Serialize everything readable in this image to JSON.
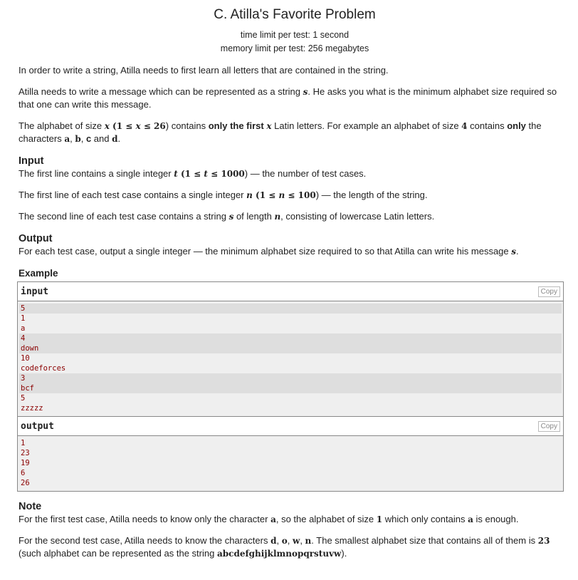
{
  "title": "C. Atilla's Favorite Problem",
  "time_limit": "time limit per test: 1 second",
  "memory_limit": "memory limit per test: 256 megabytes",
  "legend": [
    [
      {
        "t": "In order to write a string, Atilla needs to first learn all letters that are contained in the string."
      }
    ],
    [
      {
        "t": "Atilla needs to write a message which can be represented as a string "
      },
      {
        "t": "s",
        "s": "m"
      },
      {
        "t": ". He asks you what is the minimum alphabet size required so that one can write this message."
      }
    ],
    [
      {
        "t": "The alphabet of size "
      },
      {
        "t": "x",
        "s": "m"
      },
      {
        "t": " (1 ≤ ",
        "s": "mb"
      },
      {
        "t": "x",
        "s": "m"
      },
      {
        "t": " ≤ 26",
        "s": "mb"
      },
      {
        "t": ") contains "
      },
      {
        "t": "only the first ",
        "s": "b"
      },
      {
        "t": "x",
        "s": "m"
      },
      {
        "t": " Latin letters. For example an alphabet of size "
      },
      {
        "t": "4",
        "s": "mb"
      },
      {
        "t": " contains "
      },
      {
        "t": "only",
        "s": "b"
      },
      {
        "t": " the characters "
      },
      {
        "t": "a",
        "s": "mb"
      },
      {
        "t": ", "
      },
      {
        "t": "b",
        "s": "mb"
      },
      {
        "t": ", "
      },
      {
        "t": "c",
        "s": "b"
      },
      {
        "t": " and "
      },
      {
        "t": "d",
        "s": "mb"
      },
      {
        "t": "."
      }
    ]
  ],
  "input_heading": "Input",
  "input_spec": [
    [
      {
        "t": "The first line contains a single integer "
      },
      {
        "t": "t",
        "s": "m"
      },
      {
        "t": " (1 ≤ ",
        "s": "mb"
      },
      {
        "t": "t",
        "s": "m"
      },
      {
        "t": " ≤ 1000",
        "s": "mb"
      },
      {
        "t": ") — the number of test cases."
      }
    ],
    [
      {
        "t": "The first line of each test case contains a single integer "
      },
      {
        "t": "n",
        "s": "m"
      },
      {
        "t": " (1 ≤ ",
        "s": "mb"
      },
      {
        "t": "n",
        "s": "m"
      },
      {
        "t": " ≤ 100",
        "s": "mb"
      },
      {
        "t": ") — the length of the string."
      }
    ],
    [
      {
        "t": "The second line of each test case contains a string "
      },
      {
        "t": "s",
        "s": "m"
      },
      {
        "t": " of length "
      },
      {
        "t": "n",
        "s": "m"
      },
      {
        "t": ", consisting of lowercase Latin letters."
      }
    ]
  ],
  "output_heading": "Output",
  "output_spec": [
    [
      {
        "t": "For each test case, output a single integer — the minimum alphabet size required to so that Atilla can write his message "
      },
      {
        "t": "s",
        "s": "m"
      },
      {
        "t": "."
      }
    ]
  ],
  "example_heading": "Example",
  "example": {
    "input_label": "input",
    "output_label": "output",
    "copy_label": "Copy",
    "input_lines": [
      {
        "t": "5",
        "dk": true
      },
      {
        "t": "1"
      },
      {
        "t": "a"
      },
      {
        "t": "4",
        "dk": true
      },
      {
        "t": "down",
        "dk": true
      },
      {
        "t": "10"
      },
      {
        "t": "codeforces"
      },
      {
        "t": "3",
        "dk": true
      },
      {
        "t": "bcf",
        "dk": true
      },
      {
        "t": "5"
      },
      {
        "t": "zzzzz"
      }
    ],
    "output_lines": [
      {
        "t": "1"
      },
      {
        "t": "23"
      },
      {
        "t": "19"
      },
      {
        "t": "6"
      },
      {
        "t": "26"
      }
    ]
  },
  "note_heading": "Note",
  "note": [
    [
      {
        "t": "For the first test case, Atilla needs to know only the character "
      },
      {
        "t": "a",
        "s": "mb"
      },
      {
        "t": ", so the alphabet of size "
      },
      {
        "t": "1",
        "s": "mb"
      },
      {
        "t": " which only contains "
      },
      {
        "t": "a",
        "s": "mb"
      },
      {
        "t": " is enough."
      }
    ],
    [
      {
        "t": "For the second test case, Atilla needs to know the characters "
      },
      {
        "t": "d",
        "s": "mb"
      },
      {
        "t": ", "
      },
      {
        "t": "o",
        "s": "mb"
      },
      {
        "t": ", "
      },
      {
        "t": "w",
        "s": "mb"
      },
      {
        "t": ", "
      },
      {
        "t": "n",
        "s": "mb"
      },
      {
        "t": ". The smallest alphabet size that contains all of them is "
      },
      {
        "t": "23",
        "s": "mb"
      },
      {
        "t": " (such alphabet can be represented as the string "
      },
      {
        "t": "abcdefghijklmnopqrstuvw",
        "s": "mb"
      },
      {
        "t": ")."
      }
    ]
  ]
}
